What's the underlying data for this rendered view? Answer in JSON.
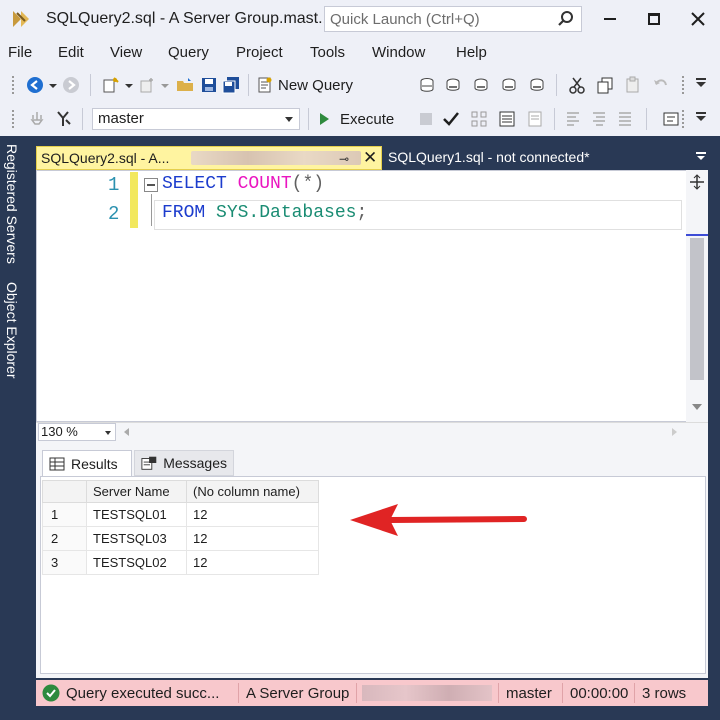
{
  "window": {
    "title": "SQLQuery2.sql - A Server Group.mast...",
    "quick_launch_placeholder": "Quick Launch (Ctrl+Q)"
  },
  "menu": [
    "File",
    "Edit",
    "View",
    "Query",
    "Project",
    "Tools",
    "Window",
    "Help"
  ],
  "toolbar": {
    "new_query_label": "New Query",
    "database": "master",
    "execute_label": "Execute"
  },
  "side_panel": {
    "registered_servers": "Registered Servers",
    "object_explorer": "Object Explorer"
  },
  "tabs": {
    "active": "SQLQuery2.sql - A...",
    "inactive": "SQLQuery1.sql - not connected*",
    "pin_glyph": "⊸",
    "close_glyph": "✕"
  },
  "editor": {
    "lines": [
      {
        "num": "1",
        "keyword": "SELECT ",
        "fn": "COUNT",
        "rest": "(*)"
      },
      {
        "num": "2",
        "keyword": "FROM ",
        "sys": "SYS.Databases",
        "rest": ";"
      }
    ]
  },
  "zoom": "130 %",
  "results": {
    "tabs": {
      "results": "Results",
      "messages": "Messages"
    },
    "columns": [
      "Server Name",
      "(No column name)"
    ],
    "rows": [
      {
        "num": "1",
        "server": "TESTSQL01",
        "count": "12"
      },
      {
        "num": "2",
        "server": "TESTSQL03",
        "count": "12"
      },
      {
        "num": "3",
        "server": "TESTSQL02",
        "count": "12"
      }
    ]
  },
  "status": {
    "message": "Query executed succ...",
    "server_group": "A Server Group",
    "database": "master",
    "elapsed": "00:00:00",
    "rows": "3 rows"
  },
  "colors": {
    "frame": "#293955",
    "active_tab": "#fff4a0",
    "status_bar": "#f8c8cc",
    "arrow": "#e02424",
    "keyword": "#1c3ccd",
    "function": "#ea16c0"
  }
}
